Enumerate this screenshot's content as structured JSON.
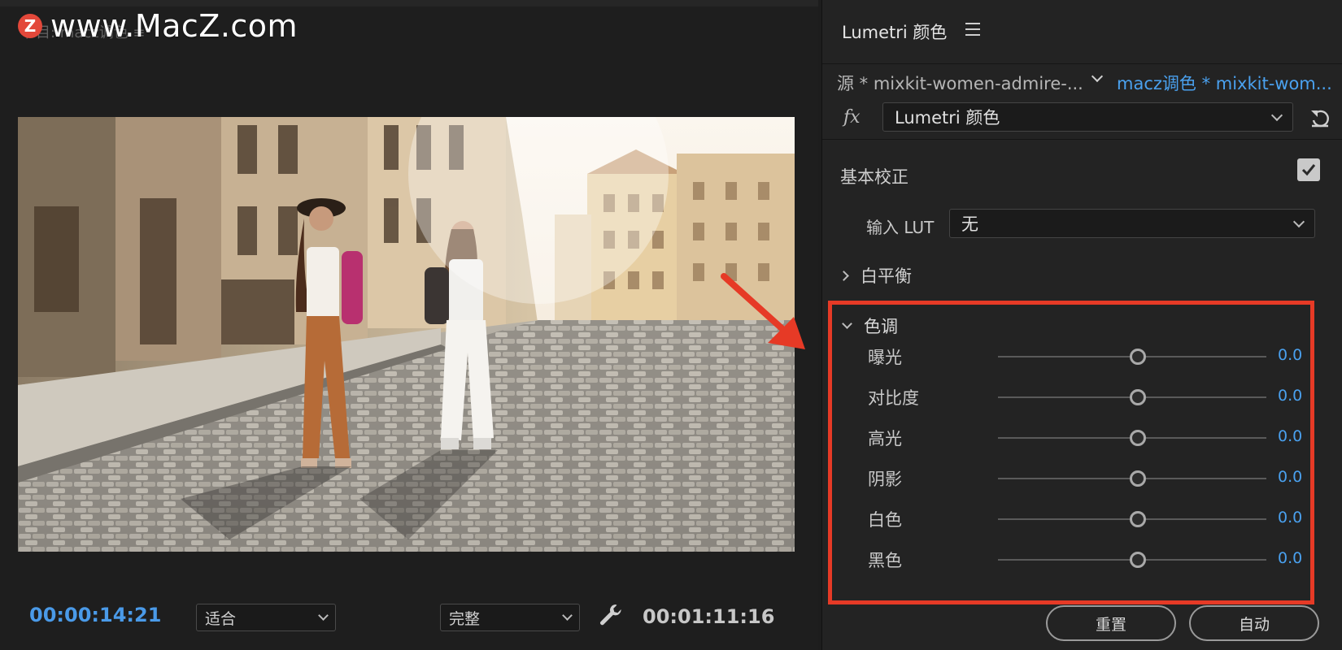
{
  "watermark": {
    "logo_letter": "Z",
    "text": "www.MacZ.com"
  },
  "monitor": {
    "title": "节目: macz调色 ≡",
    "timecode": "00:00:14:21",
    "fit": "适合",
    "quality": "完整",
    "duration": "00:01:11:16"
  },
  "panel": {
    "title": "Lumetri 颜色",
    "source": "源 * mixkit-women-admire-...",
    "clip": "macz调色 * mixkit-wom...",
    "fx_icon": "fx",
    "effect": "Lumetri 颜色",
    "basic_correction": "基本校正",
    "basic_enabled": true,
    "input_lut_label": "输入 LUT",
    "input_lut_value": "无",
    "white_balance": "白平衡",
    "tone": "色调",
    "sliders": [
      {
        "label": "曝光",
        "value": "0.0"
      },
      {
        "label": "对比度",
        "value": "0.0"
      },
      {
        "label": "高光",
        "value": "0.0"
      },
      {
        "label": "阴影",
        "value": "0.0"
      },
      {
        "label": "白色",
        "value": "0.0"
      },
      {
        "label": "黑色",
        "value": "0.0"
      }
    ],
    "reset_button": "重置",
    "auto_button": "自动"
  },
  "colors": {
    "accent": "#4aa1ef",
    "highlight": "#e63a26"
  }
}
